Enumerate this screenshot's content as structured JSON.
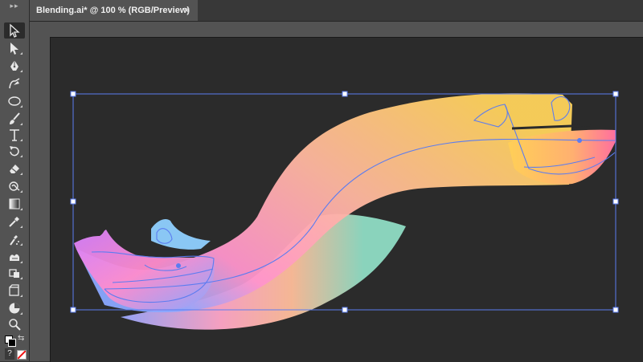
{
  "document_tab": {
    "title": "Blending.ai* @ 100 % (RGB/Preview)",
    "close_glyph": "×"
  },
  "toolbar": {
    "grip": "▸▸",
    "tools": [
      {
        "name": "selection-tool",
        "icon": "selection-arrow-icon",
        "active": true
      },
      {
        "name": "direct-selection-tool",
        "icon": "direct-selection-icon"
      },
      {
        "name": "pen-tool",
        "icon": "pen-icon"
      },
      {
        "name": "curvature-tool",
        "icon": "curvature-icon"
      },
      {
        "name": "ellipse-tool",
        "icon": "ellipse-icon"
      },
      {
        "name": "paintbrush-tool",
        "icon": "paintbrush-icon"
      },
      {
        "name": "type-tool",
        "icon": "type-icon"
      },
      {
        "name": "rotate-tool",
        "icon": "rotate-icon"
      },
      {
        "name": "eraser-tool",
        "icon": "eraser-icon"
      },
      {
        "name": "warp-tool",
        "icon": "warp-icon"
      },
      {
        "name": "gradient-tool",
        "icon": "gradient-icon"
      },
      {
        "name": "eyedropper-tool",
        "icon": "eyedropper-icon"
      },
      {
        "name": "symbol-sprayer-tool",
        "icon": "symbol-sprayer-icon"
      },
      {
        "name": "artboard-tool",
        "icon": "artboard-icon"
      },
      {
        "name": "slice-tool",
        "icon": "slice-icon"
      },
      {
        "name": "hand-tool",
        "icon": "hand-icon"
      },
      {
        "name": "zoom-tool",
        "icon": "zoom-icon"
      }
    ],
    "help_label": "?"
  },
  "colors": {
    "selection": "#5b7cf0",
    "gradient_pink": "#ff8fc8",
    "gradient_yellow": "#ffd35a",
    "gradient_blue": "#8aa7ff",
    "gradient_teal": "#7ddcc0"
  }
}
